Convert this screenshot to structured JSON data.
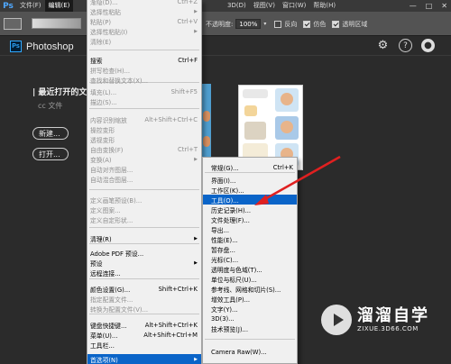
{
  "menubar": {
    "app_icon": "Ps",
    "items": [
      "文件(F)",
      "编辑(E)"
    ],
    "right_items": [
      "3D(D)",
      "视图(V)",
      "窗口(W)",
      "帮助(H)"
    ],
    "controls": [
      "—",
      "□",
      "✕"
    ]
  },
  "optbar": {
    "opacity_label": "不透明度:",
    "opacity_value": "100%",
    "reverse_label": "反向",
    "dither_label": "仿色",
    "transparency_label": "透明区域"
  },
  "home": {
    "app_name": "Photoshop",
    "icons": [
      "gear-icon",
      "help-icon",
      "user-icon"
    ],
    "help_glyph": "?",
    "recent_title": "| 最近打开的文",
    "cc_files": "cc 文件",
    "new_button": "新建...",
    "open_button": "打开..."
  },
  "edit_menu": {
    "items": [
      {
        "label": "渐隐(D)...",
        "shortcut": "Ctrl+Z",
        "disabled": true
      },
      {
        "label": "选择性粘贴",
        "shortcut": "",
        "disabled": true,
        "arrow": true
      },
      {
        "label": "粘贴(P)",
        "shortcut": "Ctrl+V",
        "disabled": true
      },
      {
        "label": "选择性粘贴(I)",
        "shortcut": "",
        "disabled": true,
        "arrow": true
      },
      {
        "label": "清除(E)",
        "shortcut": "",
        "disabled": true
      },
      {
        "label": "搜索",
        "shortcut": "Ctrl+F",
        "disabled": false
      },
      {
        "label": "拼写检查(H)...",
        "shortcut": "",
        "disabled": true
      },
      {
        "label": "查找和替换文本(X)...",
        "shortcut": "",
        "disabled": true
      },
      {
        "label": "填充(L)...",
        "shortcut": "Shift+F5",
        "disabled": true
      },
      {
        "label": "描边(S)...",
        "shortcut": "",
        "disabled": true
      },
      {
        "label": "内容识别缩放",
        "shortcut": "Alt+Shift+Ctrl+C",
        "disabled": true
      },
      {
        "label": "操控变形",
        "shortcut": "",
        "disabled": true
      },
      {
        "label": "透视变形",
        "shortcut": "",
        "disabled": true
      },
      {
        "label": "自由变换(F)",
        "shortcut": "Ctrl+T",
        "disabled": true
      },
      {
        "label": "变换(A)",
        "shortcut": "",
        "disabled": true,
        "arrow": true
      },
      {
        "label": "自动对齐图层...",
        "shortcut": "",
        "disabled": true
      },
      {
        "label": "自动混合图层...",
        "shortcut": "",
        "disabled": true
      },
      {
        "label": "定义画笔预设(B)...",
        "shortcut": "",
        "disabled": true
      },
      {
        "label": "定义图案...",
        "shortcut": "",
        "disabled": true
      },
      {
        "label": "定义自定形状...",
        "shortcut": "",
        "disabled": true
      },
      {
        "label": "清理(R)",
        "shortcut": "",
        "disabled": false,
        "arrow": true
      },
      {
        "label": "Adobe PDF 预设...",
        "shortcut": "",
        "disabled": false
      },
      {
        "label": "预设",
        "shortcut": "",
        "disabled": false,
        "arrow": true
      },
      {
        "label": "远程连接...",
        "shortcut": "",
        "disabled": false
      },
      {
        "label": "颜色设置(G)...",
        "shortcut": "Shift+Ctrl+K",
        "disabled": false
      },
      {
        "label": "指定配置文件...",
        "shortcut": "",
        "disabled": true
      },
      {
        "label": "转换为配置文件(V)...",
        "shortcut": "",
        "disabled": true
      },
      {
        "label": "键盘快捷键...",
        "shortcut": "Alt+Shift+Ctrl+K",
        "disabled": false
      },
      {
        "label": "菜单(U)...",
        "shortcut": "Alt+Shift+Ctrl+M",
        "disabled": false
      },
      {
        "label": "工具栏...",
        "shortcut": "",
        "disabled": false
      },
      {
        "label": "首选项(N)",
        "shortcut": "",
        "disabled": false,
        "arrow": true,
        "selected": true
      }
    ]
  },
  "prefs_submenu": {
    "items": [
      {
        "label": "常规(G)...",
        "shortcut": "Ctrl+K"
      },
      {
        "label": "界面(I)...",
        "shortcut": ""
      },
      {
        "label": "工作区(K)...",
        "shortcut": ""
      },
      {
        "label": "工具(O)...",
        "shortcut": "",
        "selected": true
      },
      {
        "label": "历史记录(H)...",
        "shortcut": ""
      },
      {
        "label": "文件处理(F)...",
        "shortcut": ""
      },
      {
        "label": "导出...",
        "shortcut": ""
      },
      {
        "label": "性能(E)...",
        "shortcut": ""
      },
      {
        "label": "暂存盘...",
        "shortcut": ""
      },
      {
        "label": "光标(C)...",
        "shortcut": ""
      },
      {
        "label": "透明度与色域(T)...",
        "shortcut": ""
      },
      {
        "label": "单位与标尺(U)...",
        "shortcut": ""
      },
      {
        "label": "参考线、网格和切片(S)...",
        "shortcut": ""
      },
      {
        "label": "增效工具(P)...",
        "shortcut": ""
      },
      {
        "label": "文字(Y)...",
        "shortcut": ""
      },
      {
        "label": "3D(3)...",
        "shortcut": ""
      },
      {
        "label": "技术预览(J)...",
        "shortcut": ""
      },
      {
        "label": "Camera Raw(W)...",
        "shortcut": ""
      }
    ]
  },
  "watermark": {
    "brand": "溜溜自学",
    "url": "ZIXUE.3D66.COM"
  },
  "colors": {
    "menu_selection": "#0a64c8",
    "arrow": "#e02020",
    "ps_blue": "#31a8ff"
  }
}
